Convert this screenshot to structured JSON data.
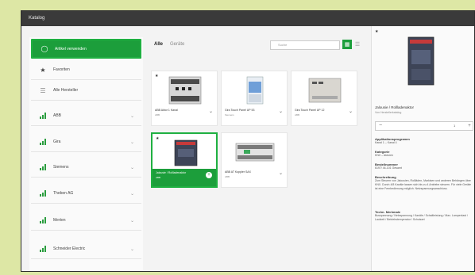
{
  "window": {
    "title": "Katalog"
  },
  "sidebar": {
    "items": [
      {
        "label": "Artikel verwenden",
        "icon": "circle-arrow-icon",
        "active": true,
        "chevron": false
      },
      {
        "label": "Favoriten",
        "icon": "star-icon",
        "active": false,
        "chevron": false
      },
      {
        "label": "Alle Hersteller",
        "icon": "list-icon",
        "active": false,
        "chevron": false
      },
      {
        "label": "ABB",
        "icon": "bar-chart-icon",
        "active": false,
        "chevron": true
      },
      {
        "label": "Gira",
        "icon": "bar-chart-icon",
        "active": false,
        "chevron": true
      },
      {
        "label": "Siemens",
        "icon": "bar-chart-icon",
        "active": false,
        "chevron": true
      },
      {
        "label": "Theben AG",
        "icon": "bar-chart-icon",
        "active": false,
        "chevron": true
      },
      {
        "label": "Merten",
        "icon": "bar-chart-icon",
        "active": false,
        "chevron": true
      },
      {
        "label": "Schneider Electric",
        "icon": "bar-chart-icon",
        "active": false,
        "chevron": true
      }
    ]
  },
  "center": {
    "tabs": [
      {
        "label": "Alle",
        "active": true
      },
      {
        "label": "Geräte",
        "active": false
      }
    ],
    "search_placeholder": "Suche",
    "products": [
      {
        "title": "ABB Aktor 1 Kanal",
        "sub": "ABB",
        "image": "din-rail-actuator",
        "selected": false
      },
      {
        "title": "Gira Touch Panel UP 53",
        "sub": "Siemens",
        "image": "blue-module",
        "selected": false
      },
      {
        "title": "Gira Touch Panel UP 12",
        "sub": "ABB",
        "image": "grey-box",
        "selected": false
      },
      {
        "title": "Jalousie / Rollladenaktor",
        "sub": "ABB",
        "image": "dark-module",
        "selected": true
      },
      {
        "title": "ABB AT Koppler SAX",
        "sub": "ABB",
        "image": "multi-terminal",
        "selected": false
      }
    ]
  },
  "detail": {
    "title": "Jalousie / Rollladenaktor",
    "subtitle": "Von Herstellerkatalog",
    "quantity": "1",
    "sections": [
      {
        "heading": "Applikationsprogramm",
        "body": "Kanal 1 – Kanal 4"
      },
      {
        "heading": "Kategorie",
        "body": "KNX – Aktoren"
      },
      {
        "heading": "Bestellnummer",
        "body": "6197/ 44-101 Gesamt"
      },
      {
        "heading": "Beschreibung",
        "body": "Zum Steuern von Jalousien, Rollläden, Markisen und anderen Behängen über KNX. Durch 4/8 Kanäle lassen sich bis zu 4 Antriebe steuern. Für viele Geräte ist eine Fernbedienung möglich. Netzspannungsanschluss."
      },
      {
        "heading": "Techn. Merkmale",
        "body": "Busspannung / Netzspannung / Kanäle / Schaltleistung / Max. Lampenlast / Laufzeit / Betriebstemperatur / Schutzart"
      }
    ]
  }
}
